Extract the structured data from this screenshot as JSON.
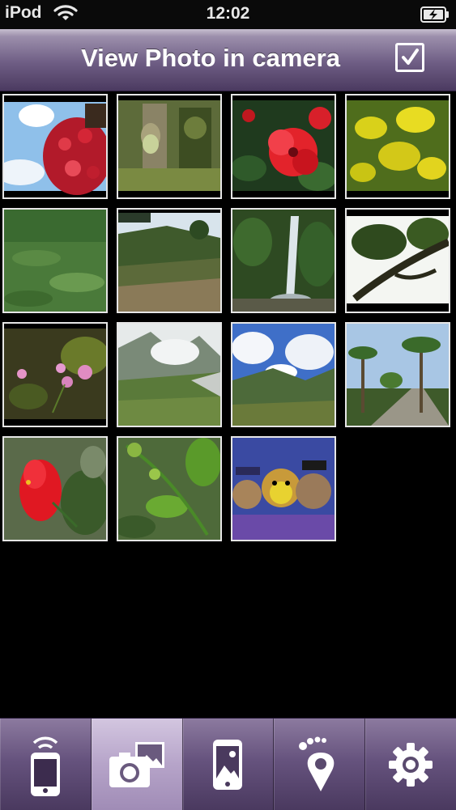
{
  "status_bar": {
    "carrier": "iPod",
    "time": "12:02",
    "icons": [
      "wifi-icon",
      "battery-charging-icon"
    ]
  },
  "nav_bar": {
    "title": "View Photo in camera",
    "select_all_checked": true
  },
  "photos": [
    {
      "subject": "red flowers against sky"
    },
    {
      "subject": "tree trunk with moss"
    },
    {
      "subject": "red azalea flowers"
    },
    {
      "subject": "yellow flowers"
    },
    {
      "subject": "green meadow"
    },
    {
      "subject": "hillside trail"
    },
    {
      "subject": "waterfall"
    },
    {
      "subject": "tree branches silhouette"
    },
    {
      "subject": "small pink flowers"
    },
    {
      "subject": "misty mountains"
    },
    {
      "subject": "valley with blue sky"
    },
    {
      "subject": "palm tree road"
    },
    {
      "subject": "red hibiscus"
    },
    {
      "subject": "green leaves and buds"
    },
    {
      "subject": "stuffed toy animals"
    }
  ],
  "tabs": [
    {
      "name": "remote",
      "icon": "phone-wireless-icon",
      "selected": false
    },
    {
      "name": "camera-photos",
      "icon": "camera-photos-icon",
      "selected": true
    },
    {
      "name": "phone-photos",
      "icon": "phone-picture-icon",
      "selected": false
    },
    {
      "name": "location",
      "icon": "footprint-pin-icon",
      "selected": false
    },
    {
      "name": "settings",
      "icon": "gear-icon",
      "selected": false
    }
  ],
  "colors": {
    "nav_bar": "#6e5d84",
    "tab_bar": "#66537e",
    "tab_selected": "#b6a4c9",
    "thumb_border": "#e6e6e6"
  }
}
